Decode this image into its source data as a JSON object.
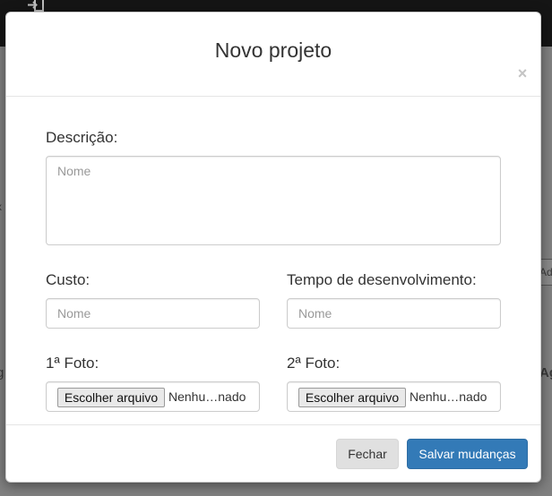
{
  "background": {
    "left_fragment_1": "x",
    "left_fragment_2": "g",
    "right_button_fragment": "Ad",
    "right_fragment_2": "Ag"
  },
  "modal": {
    "title": "Novo projeto",
    "close_symbol": "×",
    "fields": {
      "descricao": {
        "label": "Descrição:",
        "placeholder": "Nome",
        "value": ""
      },
      "custo": {
        "label": "Custo:",
        "placeholder": "Nome",
        "value": ""
      },
      "tempo": {
        "label": "Tempo de desenvolvimento:",
        "placeholder": "Nome",
        "value": ""
      },
      "foto1": {
        "label": "1ª Foto:",
        "button_label": "Escolher arquivo",
        "file_name": "Nenhu…nado"
      },
      "foto2": {
        "label": "2ª Foto:",
        "button_label": "Escolher arquivo",
        "file_name": "Nenhu…nado"
      }
    },
    "footer": {
      "close_label": "Fechar",
      "save_label": "Salvar mudanças"
    }
  },
  "colors": {
    "primary": "#337ab7",
    "overlay": "#808080",
    "topbar": "#151515"
  }
}
